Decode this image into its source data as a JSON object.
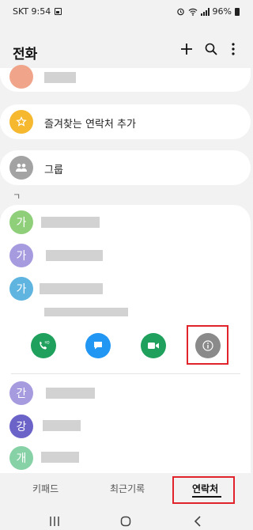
{
  "status_bar": {
    "carrier_time": "SKT 9:54",
    "battery": "96%"
  },
  "header": {
    "title": "전화"
  },
  "favorites": {
    "add_label": "즐겨찾는 연락처 추가"
  },
  "groups": {
    "label": "그룹"
  },
  "section_index": "ㄱ",
  "contacts": [
    {
      "initial": "가",
      "color": "#8fcf7a"
    },
    {
      "initial": "가",
      "color": "#a79be0"
    },
    {
      "initial": "가",
      "color": "#5fb4e0"
    },
    {
      "initial": "간",
      "color": "#a79be0"
    },
    {
      "initial": "강",
      "color": "#6c63c9"
    },
    {
      "initial": "개",
      "color": "#86d1a6"
    }
  ],
  "bottom_tabs": [
    {
      "label": "키패드",
      "active": false
    },
    {
      "label": "최근기록",
      "active": false
    },
    {
      "label": "연락처",
      "active": true
    }
  ],
  "action_icons": [
    "phone-hd-icon",
    "message-icon",
    "video-call-icon",
    "info-icon"
  ],
  "colors": {
    "highlight": "#e1242c",
    "call_green": "#1fa05d",
    "message_blue": "#2196f3",
    "info_gray": "#8a8a8a"
  }
}
